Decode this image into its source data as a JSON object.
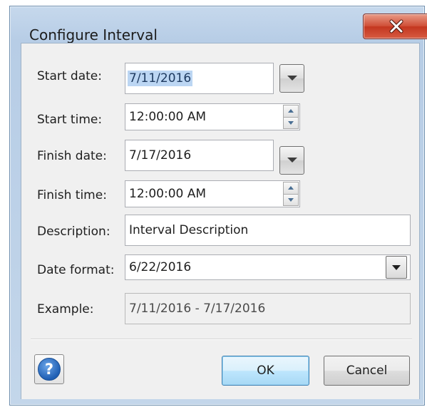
{
  "dialog": {
    "title": "Configure Interval",
    "close_label": "X"
  },
  "form": {
    "start_date": {
      "label": "Start date:",
      "value": "7/11/2016"
    },
    "start_time": {
      "label": "Start time:",
      "value": "12:00:00 AM"
    },
    "finish_date": {
      "label": "Finish date:",
      "value": "7/17/2016"
    },
    "finish_time": {
      "label": "Finish time:",
      "value": "12:00:00 AM"
    },
    "description": {
      "label": "Description:",
      "value": "Interval Description"
    },
    "date_format": {
      "label": "Date format:",
      "value": "6/22/2016"
    },
    "example": {
      "label": "Example:",
      "value": "7/11/2016 - 7/17/2016"
    }
  },
  "buttons": {
    "help": "?",
    "ok": "OK",
    "cancel": "Cancel"
  },
  "icons": {
    "close": "close-icon",
    "dropdown": "chevron-down-icon",
    "spin_up": "spin-up-icon",
    "spin_down": "spin-down-icon",
    "help": "help-icon"
  },
  "colors": {
    "title_bar": "#b7cde6",
    "close_button": "#c3361f",
    "dialog_background": "#f0f0f0",
    "selection_highlight": "#bcd6f3",
    "ok_button": "#bee6fd",
    "help_icon": "#1f5fb4"
  }
}
